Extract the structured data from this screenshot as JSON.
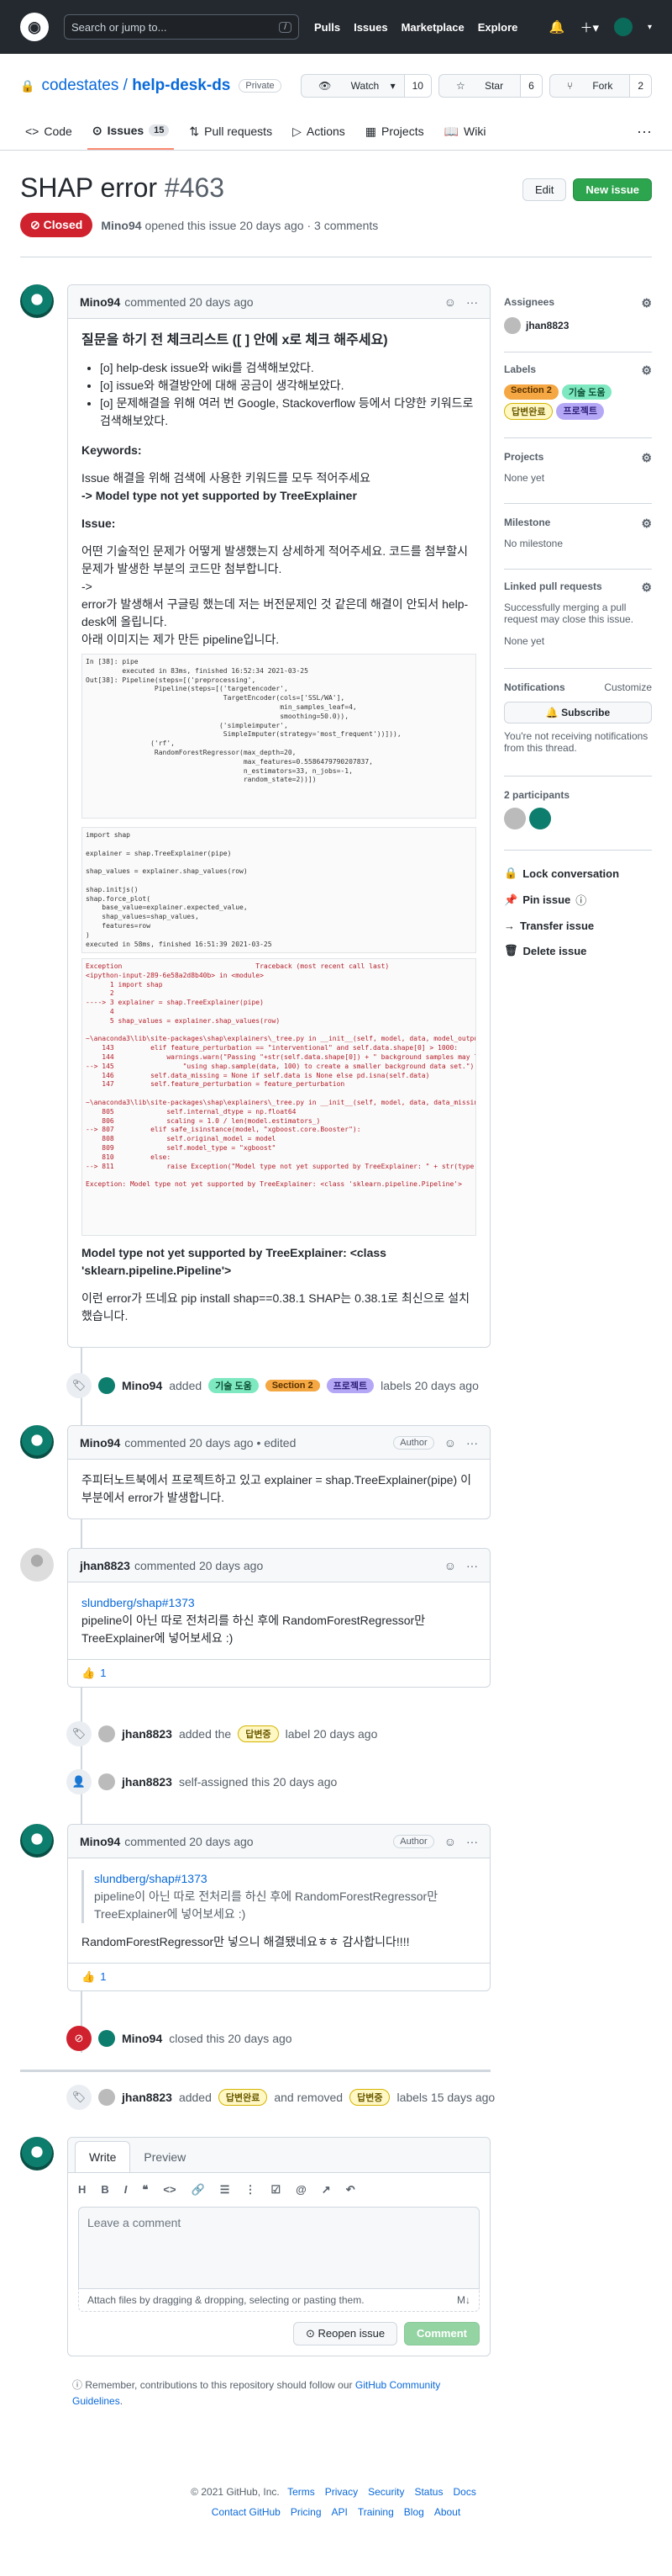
{
  "header": {
    "search_placeholder": "Search or jump to...",
    "slash": "/",
    "nav": [
      "Pulls",
      "Issues",
      "Marketplace",
      "Explore"
    ]
  },
  "repo": {
    "owner": "codestates",
    "sep": "/",
    "name": "help-desk-ds",
    "visibility": "Private",
    "watch_label": "Watch",
    "watch_count": "10",
    "star_label": "Star",
    "star_count": "6",
    "fork_label": "Fork",
    "fork_count": "2",
    "tabs": [
      {
        "label": "Code"
      },
      {
        "label": "Issues",
        "count": "15"
      },
      {
        "label": "Pull requests"
      },
      {
        "label": "Actions"
      },
      {
        "label": "Projects"
      },
      {
        "label": "Wiki"
      }
    ]
  },
  "issue": {
    "title": "SHAP error",
    "number": "#463",
    "edit": "Edit",
    "new_issue": "New issue",
    "state": "Closed",
    "author": "Mino94",
    "meta": "opened this issue 20 days ago · 3 comments"
  },
  "c1": {
    "author": "Mino94",
    "time": "commented 20 days ago",
    "heading": "질문을 하기 전 체크리스트 ([ ] 안에 x로 체크 해주세요)",
    "checklist": [
      "[o] help-desk issue와 wiki를 검색해보았다.",
      "[o] issue와 해결방안에 대해 공금이 생각해보았다.",
      "[o] 문제해결을 위해 여러 번 Google, Stackoverflow 등에서 다양한 키워드로 검색해보았다."
    ],
    "kw_title": "Keywords:",
    "kw_line1": "Issue 해결을 위해 검색에 사용한 키워드를 모두 적어주세요",
    "kw_line2": "-> Model type not yet supported by TreeExplainer",
    "issue_title": "Issue:",
    "issue_p1": "어떤 기술적인 문제가 어떻게 발생했는지 상세하게 적어주세요. 코드를 첨부할시 문제가 발생한 부분의 코드만 첨부합니다.",
    "issue_p2": "->",
    "issue_p3": "error가 발생해서 구글링 했는데 저는 버전문제인 것 같은데 해결이 안되서 help-desk에 올립니다.",
    "issue_p4": "아래 이미지는 제가 만든 pipeline입니다.",
    "code1": "In [38]: pipe\n         executed in 83ms, finished 16:52:34 2021-03-25\nOut[38]: Pipeline(steps=[('preprocessing',\n                 Pipeline(steps=[('targetencoder',\n                                  TargetEncoder(cols=['SSL/WA'],\n                                                min_samples_leaf=4,\n                                                smoothing=50.0)),\n                                 ('simpleimputer',\n                                  SimpleImputer(strategy='most_frequent'))])),\n                ('rf',\n                 RandomForestRegressor(max_depth=20,\n                                       max_features=0.5586479790207837,\n                                       n_estimators=33, n_jobs=-1,\n                                       random_state=2))])",
    "code2": "import shap\n\nexplainer = shap.TreeExplainer(pipe)\n\nshap_values = explainer.shap_values(row)\n\nshap.initjs()\nshap.force_plot(\n    base_value=explainer.expected_value,\n    shap_values=shap_values,\n    features=row\n)\nexecuted in 58ms, finished 16:51:39 2021-03-25",
    "code3": "Exception                                 Traceback (most recent call last)\n<ipython-input-289-6e58a2d8b40b> in <module>\n      1 import shap\n      2\n----> 3 explainer = shap.TreeExplainer(pipe)\n      4\n      5 shap_values = explainer.shap_values(row)\n\n~\\anaconda3\\lib\\site-packages\\shap\\explainers\\_tree.py in __init__(self, model, data, model_output, feature_perturbation, **deprecated_options)\n    143         elif feature_perturbation == \"interventional\" and self.data.shape[0] > 1000:\n    144             warnings.warn(\"Passing \"+str(self.data.shape[0]) + \" background samples may lead to slow runtimes. Consider \"\n--> 145                 \"using shap.sample(data, 100) to create a smaller background data set.\")\n    146         self.data_missing = None if self.data is None else pd.isna(self.data)\n    147         self.feature_perturbation = feature_perturbation\n\n~\\anaconda3\\lib\\site-packages\\shap\\explainers\\_tree.py in __init__(self, model, data, data_missing, model_output)\n    805             self.internal_dtype = np.float64\n    806             scaling = 1.0 / len(model.estimators_)\n--> 807         elif safe_isinstance(model, \"xgboost.core.Booster\"):\n    808             self.original_model = model\n    809             self.model_type = \"xgboost\"\n    810         else:\n--> 811             raise Exception(\"Model type not yet supported by TreeExplainer: \" + str(type(model)))\n\nException: Model type not yet supported by TreeExplainer: <class 'sklearn.pipeline.Pipeline'>",
    "bold_line": "Model type not yet supported by TreeExplainer: <class 'sklearn.pipeline.Pipeline'>",
    "last_p": "이런 error가 뜨네요 pip install shap==0.38.1 SHAP는 0.38.1로 최신으로 설치했습니다."
  },
  "ev1": {
    "actor": "Mino94",
    "verb": "added",
    "labels": [
      {
        "name": "기술 도움",
        "bg": "#7ee8c1",
        "fg": "#0a4f34"
      },
      {
        "name": "Section 2",
        "bg": "#f4a742",
        "fg": "#5a3200"
      },
      {
        "name": "프로젝트",
        "bg": "#b4a7f5",
        "fg": "#2d1f7a"
      }
    ],
    "suffix": "labels 20 days ago"
  },
  "c2": {
    "author": "Mino94",
    "time": "commented 20 days ago • edited",
    "role": "Author",
    "body": "주피터노트북에서 프로젝트하고 있고 explainer = shap.TreeExplainer(pipe) 이 부분에서 error가 발생합니다."
  },
  "c3": {
    "author": "jhan8823",
    "time": "commented 20 days ago",
    "link": "slundberg/shap#1373",
    "body": "pipeline이 아닌 따로 전처리를 하신 후에 RandomForestRegressor만 TreeExplainer에 넣어보세요 :)",
    "reaction": "👍",
    "reaction_count": "1"
  },
  "ev2": {
    "actor": "jhan8823",
    "verb": "added the",
    "label": {
      "name": "답변중",
      "bg": "#fff8c5",
      "fg": "#6b5a00"
    },
    "suffix": "label 20 days ago"
  },
  "ev3": {
    "actor": "jhan8823",
    "text": "self-assigned this 20 days ago"
  },
  "c4": {
    "author": "Mino94",
    "time": "commented 20 days ago",
    "role": "Author",
    "quote_link": "slundberg/shap#1373",
    "quote": "pipeline이 아닌 따로 전처리를 하신 후에 RandomForestRegressor만 TreeExplainer에 넣어보세요 :)",
    "body": "RandomForestRegressor만 넣으니 해결됐네요ㅎㅎ 감사합니다!!!!",
    "reaction": "👍",
    "reaction_count": "1"
  },
  "ev4": {
    "actor": "Mino94",
    "text": "closed this 20 days ago"
  },
  "ev5": {
    "actor": "jhan8823",
    "verb": "added",
    "label1": {
      "name": "답변완료",
      "bg": "#fff8c5",
      "fg": "#6b5a00"
    },
    "mid": "and removed",
    "label2": {
      "name": "답변중",
      "bg": "#fff8c5",
      "fg": "#6b5a00"
    },
    "suffix": "labels 15 days ago"
  },
  "composer": {
    "write": "Write",
    "preview": "Preview",
    "placeholder": "Leave a comment",
    "attach": "Attach files by dragging & dropping, selecting or pasting them.",
    "reopen": "Reopen issue",
    "comment": "Comment",
    "tools": [
      "H",
      "B",
      "I",
      "❝",
      "<>",
      "🔗",
      "☰",
      "⋮",
      "☑",
      "@",
      "↗",
      "↶"
    ]
  },
  "note": {
    "text": "Remember, contributions to this repository should follow our",
    "link": "GitHub Community Guidelines",
    "end": "."
  },
  "sidebar": {
    "assignees_title": "Assignees",
    "assignee": "jhan8823",
    "labels_title": "Labels",
    "labels": [
      {
        "name": "Section 2",
        "bg": "#f4a742",
        "fg": "#5a3200"
      },
      {
        "name": "기술 도움",
        "bg": "#7ee8c1",
        "fg": "#0a4f34"
      },
      {
        "name": "답변완료",
        "bg": "#fff8c5",
        "fg": "#6b5a00"
      },
      {
        "name": "프로젝트",
        "bg": "#b4a7f5",
        "fg": "#2d1f7a"
      }
    ],
    "projects_title": "Projects",
    "projects_value": "None yet",
    "milestone_title": "Milestone",
    "milestone_value": "No milestone",
    "linked_title": "Linked pull requests",
    "linked_desc": "Successfully merging a pull request may close this issue.",
    "linked_value": "None yet",
    "notif_title": "Notifications",
    "customize": "Customize",
    "subscribe": "Subscribe",
    "notif_desc": "You're not receiving notifications from this thread.",
    "participants": "2 participants",
    "actions": [
      "Lock conversation",
      "Pin issue",
      "Transfer issue",
      "Delete issue"
    ]
  },
  "footer": {
    "copyright": "© 2021 GitHub, Inc.",
    "row1": [
      "Terms",
      "Privacy",
      "Security",
      "Status",
      "Docs"
    ],
    "row2": [
      "Contact GitHub",
      "Pricing",
      "API",
      "Training",
      "Blog",
      "About"
    ]
  }
}
